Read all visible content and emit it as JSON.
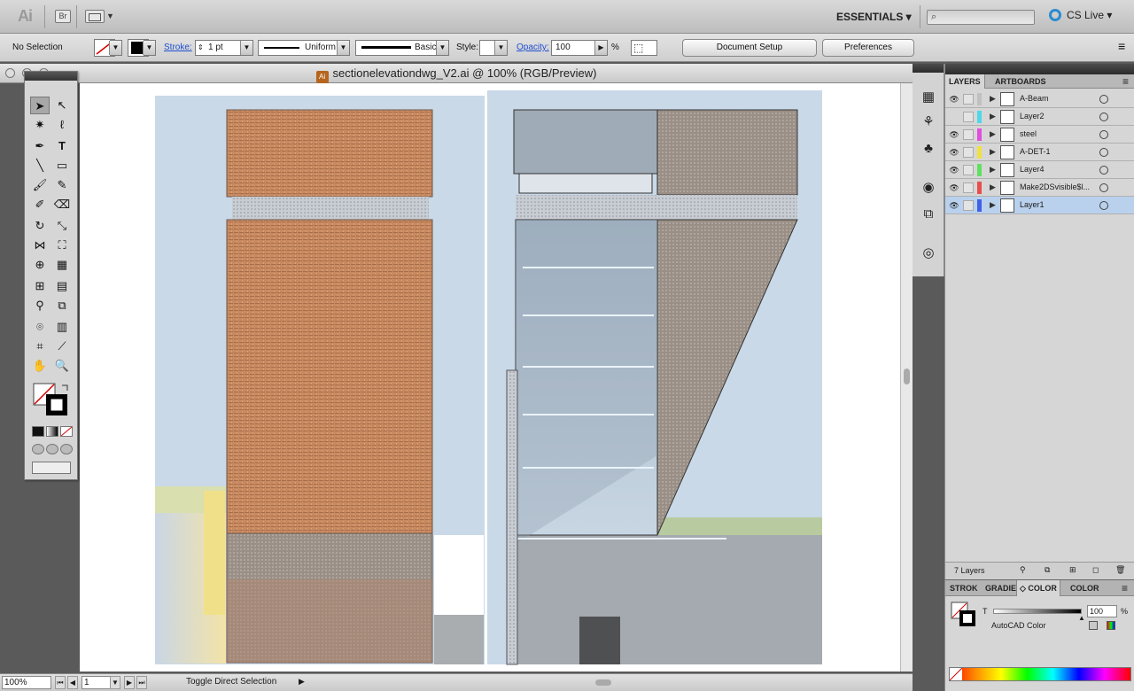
{
  "app": {
    "logo": "Ai",
    "bridge": "Br",
    "workspace": "ESSENTIALS ▾",
    "cslive": "CS Live ▾"
  },
  "control": {
    "selection": "No Selection",
    "stroke_label": "Stroke:",
    "stroke_weight": "1 pt",
    "profile": "Uniform",
    "brush": "Basic",
    "style_label": "Style:",
    "opacity_label": "Opacity:",
    "opacity_value": "100",
    "percent": "%",
    "document_setup": "Document Setup",
    "preferences": "Preferences"
  },
  "document": {
    "title": "sectionelevationdwg_V2.ai @ 100% (RGB/Preview)",
    "file_icon": "Ai"
  },
  "status": {
    "zoom": "100%",
    "page": "1",
    "text": "Toggle Direct Selection"
  },
  "layers_panel": {
    "tabs": [
      "LAYERS",
      "ARTBOARDS"
    ],
    "rows": [
      {
        "name": "A-Beam",
        "color": "#c0c0c0"
      },
      {
        "name": "Layer2",
        "color": "#4fd8e8"
      },
      {
        "name": "steel",
        "color": "#e04ee0"
      },
      {
        "name": "A-DET-1",
        "color": "#f0e040"
      },
      {
        "name": "Layer4",
        "color": "#60e060"
      },
      {
        "name": "Make2DSvisible$l...",
        "color": "#e84e4e"
      },
      {
        "name": "Layer1",
        "color": "#4060e8"
      }
    ],
    "count": "7 Layers"
  },
  "color_panel": {
    "tabs": [
      "STROK",
      "GRADIE",
      "◇ COLOR",
      "COLOR"
    ],
    "tint_label": "T",
    "tint_value": "100",
    "percent": "%",
    "mode": "AutoCAD Color"
  }
}
